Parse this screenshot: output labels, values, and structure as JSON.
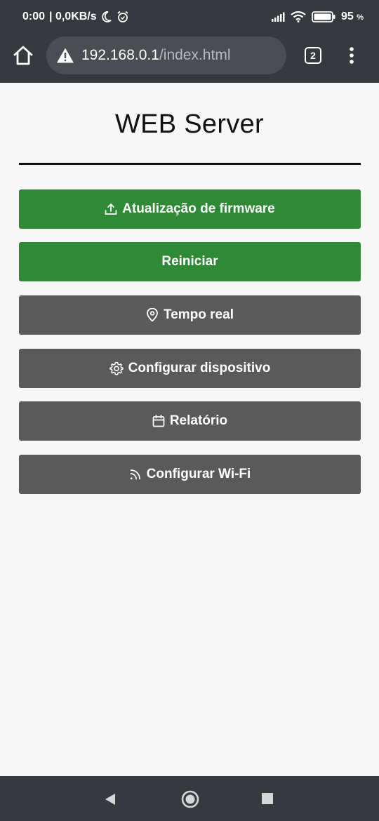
{
  "status_bar": {
    "time": "0:00",
    "network_speed": "| 0,0KB/s",
    "battery_value": "95",
    "battery_unit": "%"
  },
  "browser": {
    "url_host": "192.168.0.1",
    "url_path": "/index.html",
    "tab_count": "2"
  },
  "page": {
    "title": "WEB Server",
    "buttons": [
      {
        "label": "Atualização de firmware",
        "icon": "upload-icon",
        "color": "#2e8a34"
      },
      {
        "label": "Reiniciar",
        "icon": "",
        "color": "#2e8a34"
      },
      {
        "label": "Tempo real",
        "icon": "location-pin-icon",
        "color": "#5a5a5a"
      },
      {
        "label": "Configurar dispositivo",
        "icon": "gear-icon",
        "color": "#5a5a5a"
      },
      {
        "label": "Relatório",
        "icon": "calendar-icon",
        "color": "#5a5a5a"
      },
      {
        "label": "Configurar Wi-Fi",
        "icon": "rss-icon",
        "color": "#5a5a5a"
      }
    ]
  },
  "colors": {
    "system_bar": "#36393d",
    "url_box": "#4a4d52",
    "background": "#f7f7f7",
    "primary_green": "#2e8a34",
    "secondary_gray": "#5a5a5a"
  }
}
